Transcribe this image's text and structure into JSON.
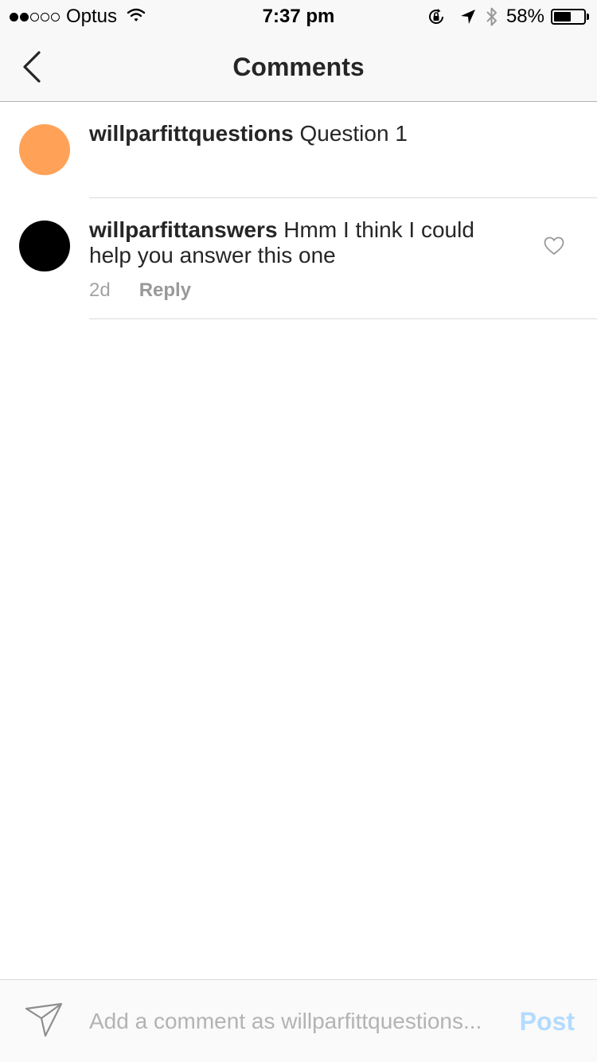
{
  "status_bar": {
    "signal_filled_dots": 2,
    "signal_total_dots": 5,
    "carrier": "Optus",
    "time": "7:37 pm",
    "battery_percent_text": "58%",
    "battery_level": 0.58,
    "icons": [
      "wifi-icon",
      "rotation-lock-icon",
      "location-arrow-icon",
      "bluetooth-icon",
      "battery-icon"
    ]
  },
  "nav": {
    "title": "Comments",
    "back_icon": "chevron-left-icon"
  },
  "comments": [
    {
      "username": "willparfittquestions",
      "text": "Question 1",
      "avatar_color": "#FFA257"
    },
    {
      "username": "willparfittanswers",
      "text": "Hmm I think I could help you answer this one",
      "avatar_color": "#000000",
      "timestamp": "2d",
      "reply_label": "Reply",
      "like_icon": "heart-outline-icon"
    }
  ],
  "input_bar": {
    "send_icon": "paper-plane-icon",
    "placeholder": "Add a comment as willparfittquestions...",
    "post_label": "Post",
    "post_color": "#B3DBFF"
  },
  "colors": {
    "bar_background": "#F8F8F8",
    "divider": "#DBDBDB",
    "text_primary": "#262626",
    "text_secondary": "#999999"
  }
}
